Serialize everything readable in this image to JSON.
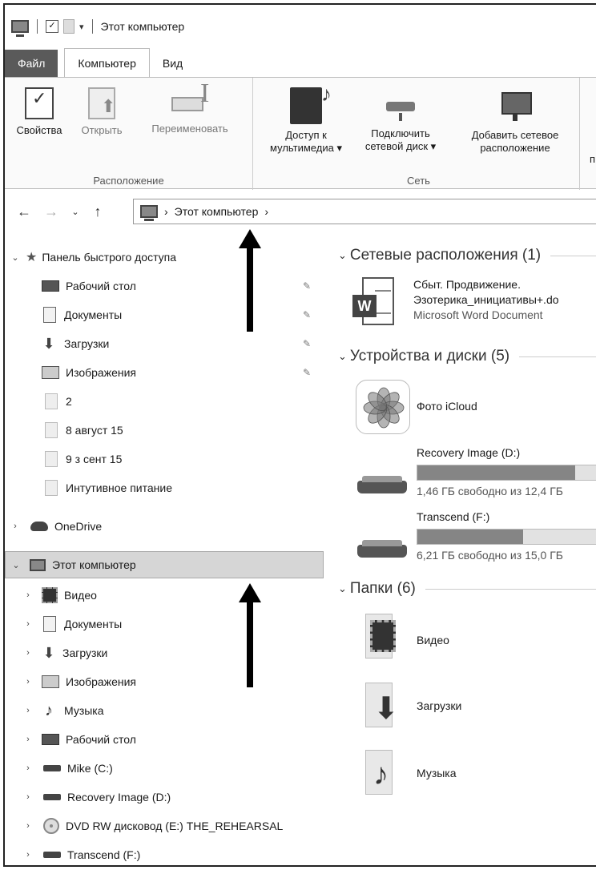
{
  "titlebar": {
    "title": "Этот компьютер"
  },
  "tabs": [
    {
      "label": "Файл"
    },
    {
      "label": "Компьютер"
    },
    {
      "label": "Вид"
    }
  ],
  "ribbon": {
    "groups": [
      {
        "label": "Расположение",
        "buttons": [
          {
            "label": "Свойства",
            "icon": "properties-icon"
          },
          {
            "label": "Открыть",
            "icon": "open-icon"
          },
          {
            "label": "Переименовать",
            "icon": "rename-icon"
          }
        ]
      },
      {
        "label": "Сеть",
        "buttons": [
          {
            "line1": "Доступ к",
            "line2": "мультимедиа ▾",
            "icon": "media-access-icon"
          },
          {
            "line1": "Подключить",
            "line2": "сетевой диск ▾",
            "icon": "network-drive-icon"
          },
          {
            "line1": "Добавить сетевое",
            "line2": "расположение",
            "icon": "network-location-icon"
          }
        ]
      }
    ],
    "cut_letter": "п"
  },
  "nav": {
    "back": "←",
    "forward": "→",
    "recent": "⌄",
    "up": "↑",
    "address": "Этот компьютер",
    "address_sep": "›"
  },
  "leftpane": {
    "quick_access": "Панель быстрого доступа",
    "quick_items": [
      {
        "label": "Рабочий стол",
        "icon": "desktop-icon",
        "pinned": true
      },
      {
        "label": "Документы",
        "icon": "documents-icon",
        "pinned": true
      },
      {
        "label": "Загрузки",
        "icon": "downloads-icon",
        "pinned": true
      },
      {
        "label": "Изображения",
        "icon": "pictures-icon",
        "pinned": true
      },
      {
        "label": "2",
        "icon": "folder-icon"
      },
      {
        "label": "8 август 15",
        "icon": "folder-icon"
      },
      {
        "label": "9 з сент 15",
        "icon": "folder-icon"
      },
      {
        "label": "Интутивное питание",
        "icon": "folder-icon"
      }
    ],
    "onedrive": "OneDrive",
    "this_pc": "Этот компьютер",
    "pc_items": [
      {
        "label": "Видео",
        "icon": "video-icon"
      },
      {
        "label": "Документы",
        "icon": "documents-icon"
      },
      {
        "label": "Загрузки",
        "icon": "downloads-icon"
      },
      {
        "label": "Изображения",
        "icon": "pictures-icon"
      },
      {
        "label": "Музыка",
        "icon": "music-icon"
      },
      {
        "label": "Рабочий стол",
        "icon": "desktop-icon"
      },
      {
        "label": "Mike (C:)",
        "icon": "system-drive-icon"
      },
      {
        "label": "Recovery Image (D:)",
        "icon": "drive-icon"
      },
      {
        "label": "DVD RW дисковод (E:) THE_REHEARSAL",
        "icon": "dvd-icon"
      },
      {
        "label": "Transcend (F:)",
        "icon": "drive-icon"
      }
    ]
  },
  "content": {
    "network_header": "Сетевые расположения (1)",
    "network_file": {
      "line1": "Сбыт. Продвижение.",
      "line2": "Эзотерика_инициативы+.do",
      "line3": "Microsoft Word Document"
    },
    "devices_header": "Устройства и диски (5)",
    "icloud": "Фото iCloud",
    "drives": [
      {
        "name": "Recovery Image (D:)",
        "free": "1,46 ГБ свободно из 12,4 ГБ",
        "used_fraction": 0.88
      },
      {
        "name": "Transcend (F:)",
        "free": "6,21 ГБ свободно из 15,0 ГБ",
        "used_fraction": 0.59
      }
    ],
    "folders_header": "Папки (6)",
    "folders": [
      {
        "label": "Видео",
        "icon": "video-folder-icon"
      },
      {
        "label": "Загрузки",
        "icon": "downloads-folder-icon"
      },
      {
        "label": "Музыка",
        "icon": "music-folder-icon"
      }
    ]
  }
}
